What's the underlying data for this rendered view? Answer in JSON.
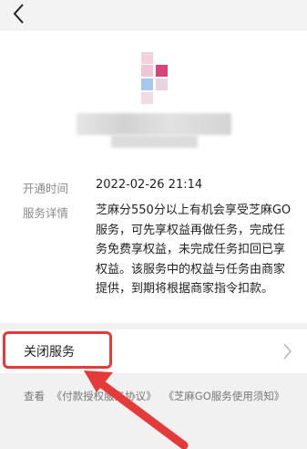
{
  "nav": {
    "back_icon": "chevron-left-icon"
  },
  "colors": {
    "highlight": "#e53a3a",
    "logo_pink": "#d6447c",
    "logo_blue": "#a8c7ee",
    "logo_light_pink": "#f2c5d4"
  },
  "service": {
    "open_time_label": "开通时间",
    "open_time_value": "2022-02-26 21:14",
    "detail_label": "服务详情",
    "detail_value": "芝麻分550分以上有机会享受芝麻GO服务，可先享权益再做任务，完成任务免费享权益，未完成任务扣回已享权益。该服务中的权益与任务由商家提供，到期将根据商家指令扣款。"
  },
  "actions": {
    "close_service_label": "关闭服务",
    "chevron_icon": "chevron-right-icon"
  },
  "footer": {
    "prefix": "查看",
    "link1": "《付款授权服务协议》",
    "link2": "《芝麻GO服务使用须知》"
  }
}
